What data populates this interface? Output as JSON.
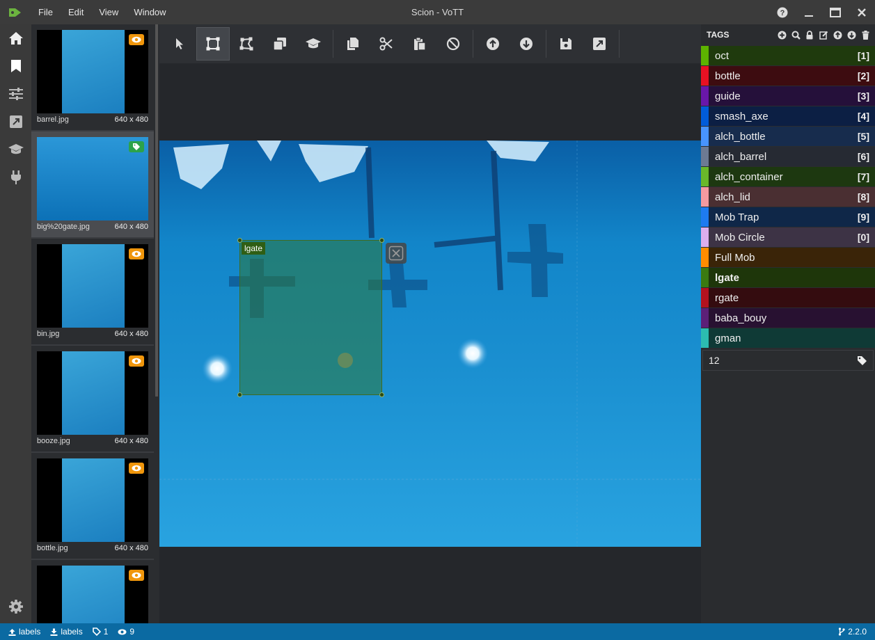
{
  "window": {
    "title": "Scion - VoTT"
  },
  "menu": [
    "File",
    "Edit",
    "View",
    "Window"
  ],
  "thumbnails": [
    {
      "name": "barrel.jpg",
      "size": "640 x 480",
      "badge": "eye",
      "active": false
    },
    {
      "name": "big%20gate.jpg",
      "size": "640 x 480",
      "badge": "tag",
      "active": true
    },
    {
      "name": "bin.jpg",
      "size": "640 x 480",
      "badge": "eye",
      "active": false
    },
    {
      "name": "booze.jpg",
      "size": "640 x 480",
      "badge": "eye",
      "active": false
    },
    {
      "name": "bottle.jpg",
      "size": "640 x 480",
      "badge": "eye",
      "active": false
    },
    {
      "name": "",
      "size": "",
      "badge": "eye",
      "active": false
    }
  ],
  "region": {
    "label": "lgate"
  },
  "tags_panel": {
    "title": "TAGS",
    "tags": [
      {
        "name": "oct",
        "key": "[1]",
        "color": "#5db300",
        "bg": "#1f3a0d"
      },
      {
        "name": "bottle",
        "key": "[2]",
        "color": "#e81123",
        "bg": "#3d0c10"
      },
      {
        "name": "guide",
        "key": "[3]",
        "color": "#6917aa",
        "bg": "#25103a"
      },
      {
        "name": "smash_axe",
        "key": "[4]",
        "color": "#015cda",
        "bg": "#0c1f44"
      },
      {
        "name": "alch_bottle",
        "key": "[5]",
        "color": "#4894fe",
        "bg": "#172c4d"
      },
      {
        "name": "alch_barrel",
        "key": "[6]",
        "color": "#6d7a93",
        "bg": "#262a33"
      },
      {
        "name": "alch_container",
        "key": "[7]",
        "color": "#6ab82a",
        "bg": "#1d3810"
      },
      {
        "name": "alch_lid",
        "key": "[8]",
        "color": "#f49aa0",
        "bg": "#4a2f32"
      },
      {
        "name": "Mob Trap",
        "key": "[9]",
        "color": "#1e7bf0",
        "bg": "#0f2748"
      },
      {
        "name": "Mob Circle",
        "key": "[0]",
        "color": "#dcaeee",
        "bg": "#3d3345"
      },
      {
        "name": "Full Mob",
        "key": "",
        "color": "#ff8c00",
        "bg": "#3a2408"
      },
      {
        "name": "lgate",
        "key": "",
        "color": "#3b7a10",
        "bg": "#1e360a",
        "selected": true
      },
      {
        "name": "rgate",
        "key": "",
        "color": "#b3121e",
        "bg": "#340c0f"
      },
      {
        "name": "baba_bouy",
        "key": "",
        "color": "#5c2078",
        "bg": "#281131"
      },
      {
        "name": "gman",
        "key": "",
        "color": "#2cbcb0",
        "bg": "#0f3a36"
      }
    ],
    "input_value": "12"
  },
  "status": {
    "export_target": "labels",
    "import_source": "labels",
    "tagged_count": "1",
    "visited_count": "9",
    "version": "2.2.0"
  }
}
